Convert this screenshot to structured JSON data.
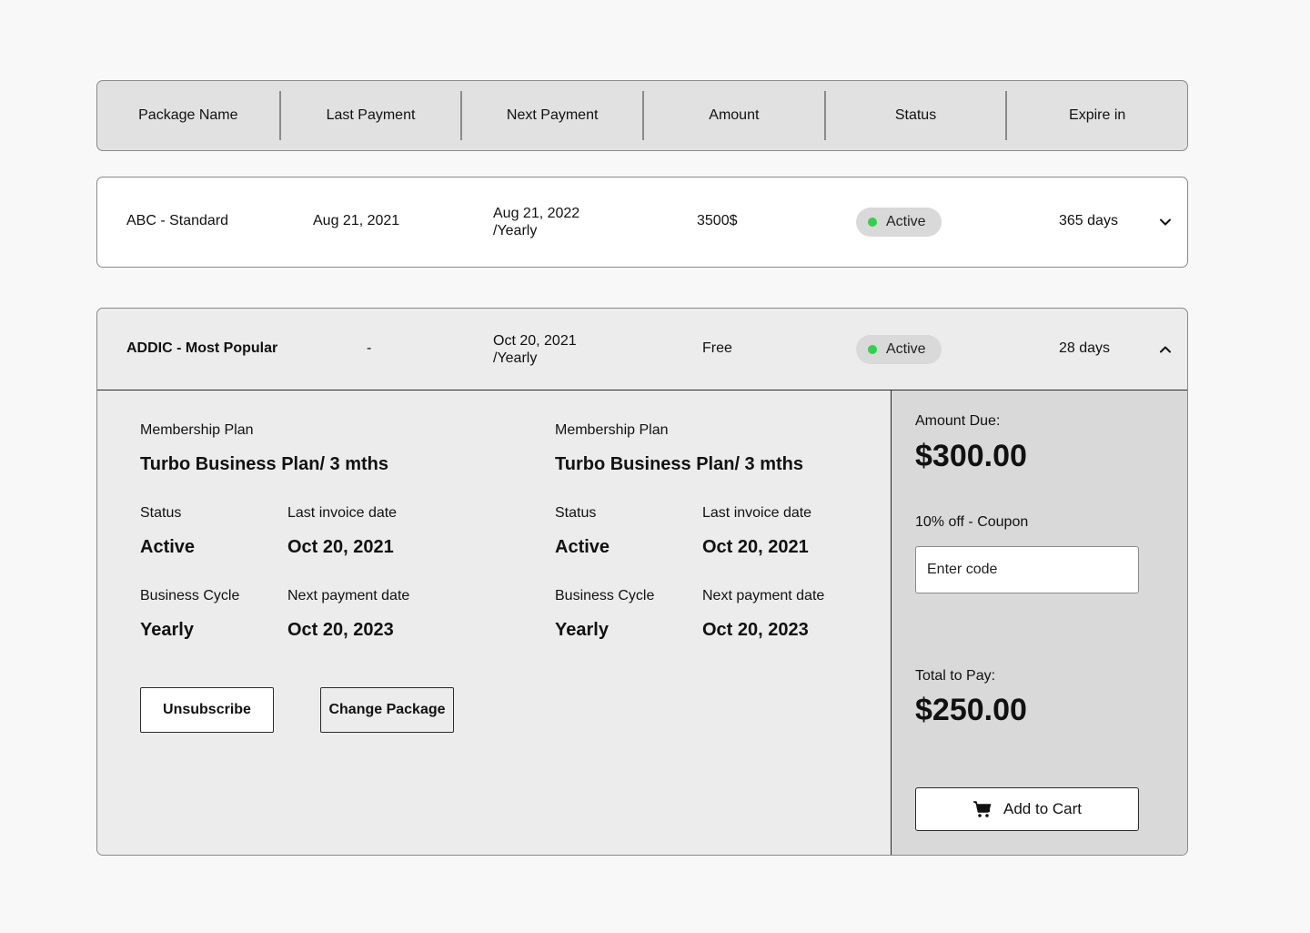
{
  "table_header": {
    "columns": [
      "Package Name",
      "Last Payment",
      "Next Payment",
      "Amount",
      "Status",
      "Expire in"
    ]
  },
  "rows": [
    {
      "package_name": "ABC - Standard",
      "last_payment": "Aug 21, 2021",
      "next_payment_date": "Aug 21, 2022",
      "next_payment_cycle": "/Yearly",
      "amount": "3500$",
      "status": "Active",
      "expire_in": "365 days",
      "toggle_icon": "chevron-down-icon"
    },
    {
      "package_name": "ADDIC - Most Popular",
      "last_payment": "-",
      "next_payment_date": "Oct 20, 2021",
      "next_payment_cycle": "/Yearly",
      "amount": "Free",
      "status": "Active",
      "expire_in": "28 days",
      "toggle_icon": "chevron-up-icon"
    }
  ],
  "details": {
    "plans": [
      {
        "plan_label": "Membership Plan",
        "plan_name": "Turbo Business Plan/ 3 mths",
        "status_label": "Status",
        "status_value": "Active",
        "last_invoice_label": "Last invoice date",
        "last_invoice_value": "Oct 20, 2021",
        "cycle_label": "Business Cycle",
        "cycle_value": "Yearly",
        "next_payment_label": "Next payment date",
        "next_payment_value": "Oct 20, 2023"
      },
      {
        "plan_label": "Membership Plan",
        "plan_name": "Turbo Business Plan/ 3 mths",
        "status_label": "Status",
        "status_value": "Active",
        "last_invoice_label": "Last invoice date",
        "last_invoice_value": "Oct 20, 2021",
        "cycle_label": "Business Cycle",
        "cycle_value": "Yearly",
        "next_payment_label": "Next payment date",
        "next_payment_value": "Oct 20, 2023"
      }
    ],
    "unsubscribe_label": "Unsubscribe",
    "change_package_label": "Change Package"
  },
  "payment": {
    "amount_due_label": "Amount Due:",
    "amount_due_value": "$300.00",
    "coupon_label": "10% off - Coupon",
    "coupon_placeholder": "Enter code",
    "total_label": "Total to Pay:",
    "total_value": "$250.00",
    "add_to_cart_label": "Add to Cart",
    "cart_icon": "cart-icon"
  },
  "colors": {
    "status_dot": "#2fd24a",
    "header_bg": "#e1e1e1",
    "expanded_bg": "#ececec",
    "sidebar_bg": "#d9d9d9"
  }
}
